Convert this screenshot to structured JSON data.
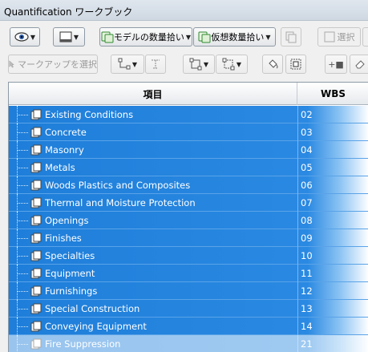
{
  "window": {
    "title": "Quantification ワークブック"
  },
  "toolbar1": {
    "model_takeoff": "モデルの数量拾い",
    "virtual_takeoff": "仮想数量拾い",
    "select": "選択"
  },
  "toolbar2": {
    "markup_select": "マークアップを選択",
    "plus_label": "+■"
  },
  "grid": {
    "headers": {
      "item": "項目",
      "wbs": "WBS"
    },
    "rows": [
      {
        "name": "Existing Conditions",
        "wbs": "02"
      },
      {
        "name": "Concrete",
        "wbs": "03"
      },
      {
        "name": "Masonry",
        "wbs": "04"
      },
      {
        "name": "Metals",
        "wbs": "05"
      },
      {
        "name": "Woods Plastics and Composites",
        "wbs": "06"
      },
      {
        "name": "Thermal and Moisture Protection",
        "wbs": "07"
      },
      {
        "name": "Openings",
        "wbs": "08"
      },
      {
        "name": "Finishes",
        "wbs": "09"
      },
      {
        "name": "Specialties",
        "wbs": "10"
      },
      {
        "name": "Equipment",
        "wbs": "11"
      },
      {
        "name": "Furnishings",
        "wbs": "12"
      },
      {
        "name": "Special Construction",
        "wbs": "13"
      },
      {
        "name": "Conveying Equipment",
        "wbs": "14"
      },
      {
        "name": "Fire Suppression",
        "wbs": "21"
      }
    ]
  },
  "colors": {
    "selection": "#1e7ed9",
    "border": "#8e9aa6"
  }
}
